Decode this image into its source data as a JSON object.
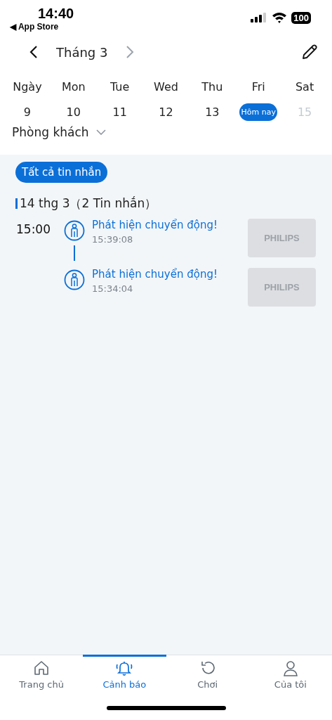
{
  "status_bar": {
    "time": "14:40",
    "back_label": "◀ App Store",
    "battery": "100"
  },
  "header": {
    "month": "Tháng 3",
    "next_disabled": true
  },
  "weekdays": [
    "Ngày",
    "Mon",
    "Tue",
    "Wed",
    "Thu",
    "Fri",
    "Sat"
  ],
  "days": [
    {
      "label": "9",
      "selected": false,
      "disabled": false
    },
    {
      "label": "10",
      "selected": false,
      "disabled": false
    },
    {
      "label": "11",
      "selected": false,
      "disabled": false
    },
    {
      "label": "12",
      "selected": false,
      "disabled": false
    },
    {
      "label": "13",
      "selected": false,
      "disabled": false
    },
    {
      "label": "Hôm nay",
      "selected": true,
      "disabled": false
    },
    {
      "label": "15",
      "selected": false,
      "disabled": true
    }
  ],
  "room": "Phòng khách",
  "filter": {
    "label": "Tất cả tin nhắn",
    "selected": true
  },
  "group": {
    "date": "14 thg 3（2 Tin nhắn）",
    "hour": "15:00",
    "events": [
      {
        "title": "Phát hiện chuyển động!",
        "time": "15:39:08",
        "thumbnail_label": "PHILIPS"
      },
      {
        "title": "Phát hiện chuyển động!",
        "time": "15:34:04",
        "thumbnail_label": "PHILIPS"
      }
    ]
  },
  "tab_bar": [
    {
      "kind": "home",
      "label": "Trang chủ",
      "selected": false
    },
    {
      "kind": "bell",
      "label": "Cảnh báo",
      "selected": true
    },
    {
      "kind": "replay",
      "label": "Chơi",
      "selected": false
    },
    {
      "kind": "person",
      "label": "Của tôi",
      "selected": false
    }
  ]
}
